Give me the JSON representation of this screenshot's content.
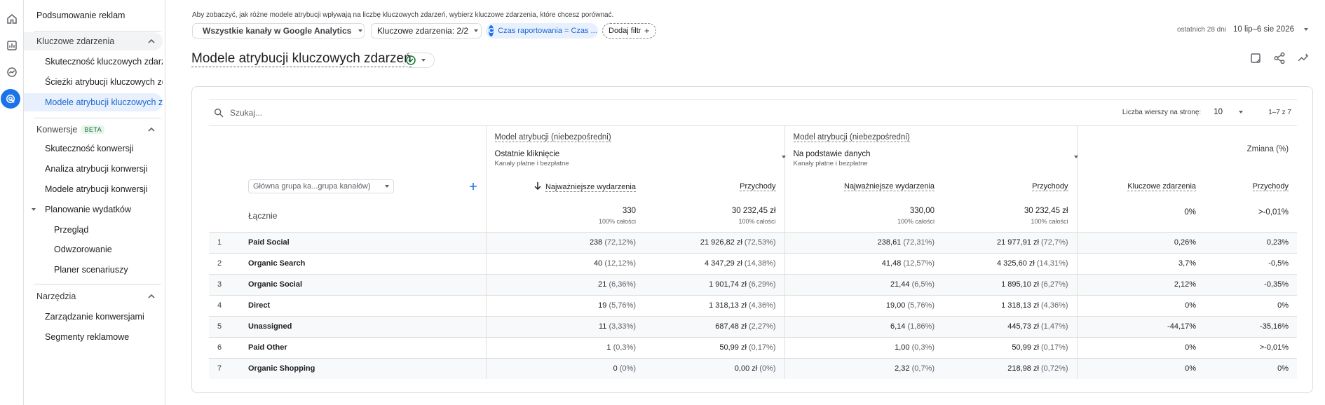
{
  "rail": {
    "icons": [
      "home-icon",
      "bar-chart-icon",
      "explore-icon",
      "advertising-icon"
    ]
  },
  "sidebar": {
    "summary": "Podsumowanie reklam",
    "key_events": {
      "label": "Kluczowe zdarzenia",
      "items": [
        "Skuteczność kluczowych zdarzeń",
        "Ścieżki atrybucji kluczowych zdarzeń",
        "Modele atrybucji kluczowych zdarzeń"
      ]
    },
    "conversions": {
      "label": "Konwersje",
      "badge": "BETA",
      "items": [
        "Skuteczność konwersji",
        "Analiza atrybucji konwersji",
        "Modele atrybucji konwersji"
      ],
      "planning": {
        "label": "Planowanie wydatków",
        "items": [
          "Przegląd",
          "Odwzorowanie",
          "Planer scenariuszy"
        ]
      }
    },
    "tools": {
      "label": "Narzędzia",
      "items": [
        "Zarządzanie konwersjami",
        "Segmenty reklamowe"
      ]
    }
  },
  "header": {
    "hint": "Aby zobaczyć, jak różne modele atrybucji wpływają na liczbę kluczowych zdarzeń, wybierz kluczowe zdarzenia, które chcesz porównać.",
    "channel_chip": "Wszystkie kanały w Google Analytics",
    "events_chip": "Kluczowe zdarzenia: 2/2",
    "filter_chip": "Czas raportowania = Czas ...",
    "filter_chip_letter": "C",
    "add_filter": "Dodaj filtr",
    "date_label": "ostatnich 28 dni",
    "date_range": "10 lip–6 sie 2026"
  },
  "page": {
    "title": "Modele atrybucji kluczowych zdarzeń"
  },
  "table": {
    "search_placeholder": "Szukaj...",
    "rows_per_page_label": "Liczba wierszy na stronę:",
    "rows_per_page": "10",
    "pagination": "1–7 z 7",
    "model_left": {
      "title": "Model atrybucji (niebezpośredni)",
      "name": "Ostatnie kliknięcie",
      "sub": "Kanały płatne i bezpłatne"
    },
    "model_right": {
      "title": "Model atrybucji (niebezpośredni)",
      "name": "Na podstawie danych",
      "sub": "Kanały płatne i bezpłatne"
    },
    "change_header": "Zmiana (%)",
    "dimension_select": "Główna grupa ka...grupa kanałów)",
    "columns": {
      "key_events": "Najważniejsze wydarzenia",
      "revenue": "Przychody",
      "change_key": "Kluczowe zdarzenia",
      "change_rev": "Przychody"
    },
    "totals": {
      "label": "Łącznie",
      "l_events": "330",
      "l_events_pct": "100% całości",
      "l_rev": "30 232,45 zł",
      "l_rev_pct": "100% całości",
      "r_events": "330,00",
      "r_events_pct": "100% całości",
      "r_rev": "30 232,45 zł",
      "r_rev_pct": "100% całości",
      "ch_events": "0%",
      "ch_rev": ">-0,01%"
    },
    "rows": [
      {
        "idx": "1",
        "name": "Paid Social",
        "l_ev": "238",
        "l_ev_p": "(72,12%)",
        "l_rev": "21 926,82 zł",
        "l_rev_p": "(72,53%)",
        "r_ev": "238,61",
        "r_ev_p": "(72,31%)",
        "r_rev": "21 977,91 zł",
        "r_rev_p": "(72,7%)",
        "ch_ev": "0,26%",
        "ch_rev": "0,23%"
      },
      {
        "idx": "2",
        "name": "Organic Search",
        "l_ev": "40",
        "l_ev_p": "(12,12%)",
        "l_rev": "4 347,29 zł",
        "l_rev_p": "(14,38%)",
        "r_ev": "41,48",
        "r_ev_p": "(12,57%)",
        "r_rev": "4 325,60 zł",
        "r_rev_p": "(14,31%)",
        "ch_ev": "3,7%",
        "ch_rev": "-0,5%"
      },
      {
        "idx": "3",
        "name": "Organic Social",
        "l_ev": "21",
        "l_ev_p": "(6,36%)",
        "l_rev": "1 901,74 zł",
        "l_rev_p": "(6,29%)",
        "r_ev": "21,44",
        "r_ev_p": "(6,5%)",
        "r_rev": "1 895,10 zł",
        "r_rev_p": "(6,27%)",
        "ch_ev": "2,12%",
        "ch_rev": "-0,35%"
      },
      {
        "idx": "4",
        "name": "Direct",
        "l_ev": "19",
        "l_ev_p": "(5,76%)",
        "l_rev": "1 318,13 zł",
        "l_rev_p": "(4,36%)",
        "r_ev": "19,00",
        "r_ev_p": "(5,76%)",
        "r_rev": "1 318,13 zł",
        "r_rev_p": "(4,36%)",
        "ch_ev": "0%",
        "ch_rev": "0%"
      },
      {
        "idx": "5",
        "name": "Unassigned",
        "l_ev": "11",
        "l_ev_p": "(3,33%)",
        "l_rev": "687,48 zł",
        "l_rev_p": "(2,27%)",
        "r_ev": "6,14",
        "r_ev_p": "(1,86%)",
        "r_rev": "445,73 zł",
        "r_rev_p": "(1,47%)",
        "ch_ev": "-44,17%",
        "ch_rev": "-35,16%"
      },
      {
        "idx": "6",
        "name": "Paid Other",
        "l_ev": "1",
        "l_ev_p": "(0,3%)",
        "l_rev": "50,99 zł",
        "l_rev_p": "(0,17%)",
        "r_ev": "1,00",
        "r_ev_p": "(0,3%)",
        "r_rev": "50,99 zł",
        "r_rev_p": "(0,17%)",
        "ch_ev": "0%",
        "ch_rev": ">-0,01%"
      },
      {
        "idx": "7",
        "name": "Organic Shopping",
        "l_ev": "0",
        "l_ev_p": "(0%)",
        "l_rev": "0,00 zł",
        "l_rev_p": "(0%)",
        "r_ev": "2,32",
        "r_ev_p": "(0,7%)",
        "r_rev": "218,98 zł",
        "r_rev_p": "(0,72%)",
        "ch_ev": "0%",
        "ch_rev": "0%"
      }
    ]
  },
  "colors": {
    "accent": "#1a73e8",
    "selected_bg": "#e8f0fe",
    "border": "#dadce0",
    "shaded_row": "#f8f9fa"
  }
}
